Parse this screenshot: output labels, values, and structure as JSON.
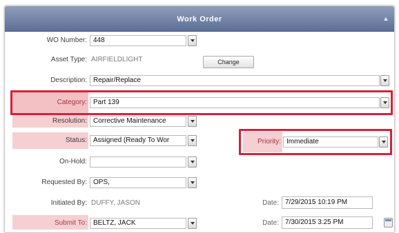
{
  "window": {
    "title": "Work Order"
  },
  "form": {
    "wo_number": {
      "label": "WO Number:",
      "value": "448"
    },
    "asset_type": {
      "label": "Asset Type:",
      "value": "AIRFIELDLIGHT",
      "change_label": "Change"
    },
    "description": {
      "label": "Description:",
      "value": "Repair/Replace"
    },
    "category": {
      "label": "Category:",
      "value": "Part 139"
    },
    "resolution": {
      "label": "Resolution:",
      "value": "Corrective Maintenance"
    },
    "status": {
      "label": "Status:",
      "value": "Assigned (Ready To Wor"
    },
    "priority": {
      "label": "Priority:",
      "value": "Immediate"
    },
    "on_hold": {
      "label": "On-Hold:",
      "value": ""
    },
    "requested_by": {
      "label": "Requested By:",
      "value": "OPS,"
    },
    "initiated_by": {
      "label": "Initiated By:",
      "value": "DUFFY, JASON"
    },
    "initiated_date": {
      "label": "Date:",
      "value": "7/29/2015 10:19 PM"
    },
    "submit_to": {
      "label": "Submit To:",
      "value": "BELTZ, JACK"
    },
    "submit_date": {
      "label": "Date:",
      "value": "7/30/2015 3:25 PM"
    }
  },
  "colors": {
    "highlight": "#d8203a",
    "required_label_bg": "#f5cfd2",
    "titlebar": "#6f7fa3"
  }
}
